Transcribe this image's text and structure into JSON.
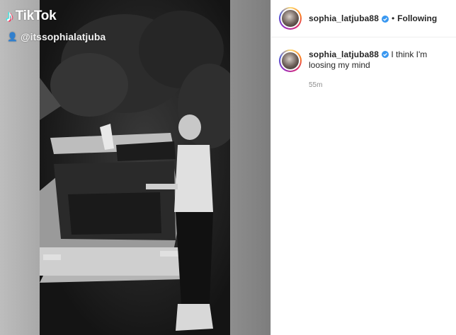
{
  "video": {
    "brand_name": "TikTok",
    "brand_glyph": "♪",
    "handle": "@itssophialatjuba",
    "user_glyph": "👤"
  },
  "post": {
    "header": {
      "username": "sophia_latjuba88",
      "separator": "•",
      "follow_status": "Following"
    },
    "caption": {
      "username": "sophia_latjuba88",
      "text": "I think I'm loosing my mind",
      "timestamp": "55m"
    }
  },
  "colors": {
    "verified_blue": "#3897f0",
    "text_primary": "#262626",
    "text_secondary": "#8e8e8e"
  }
}
